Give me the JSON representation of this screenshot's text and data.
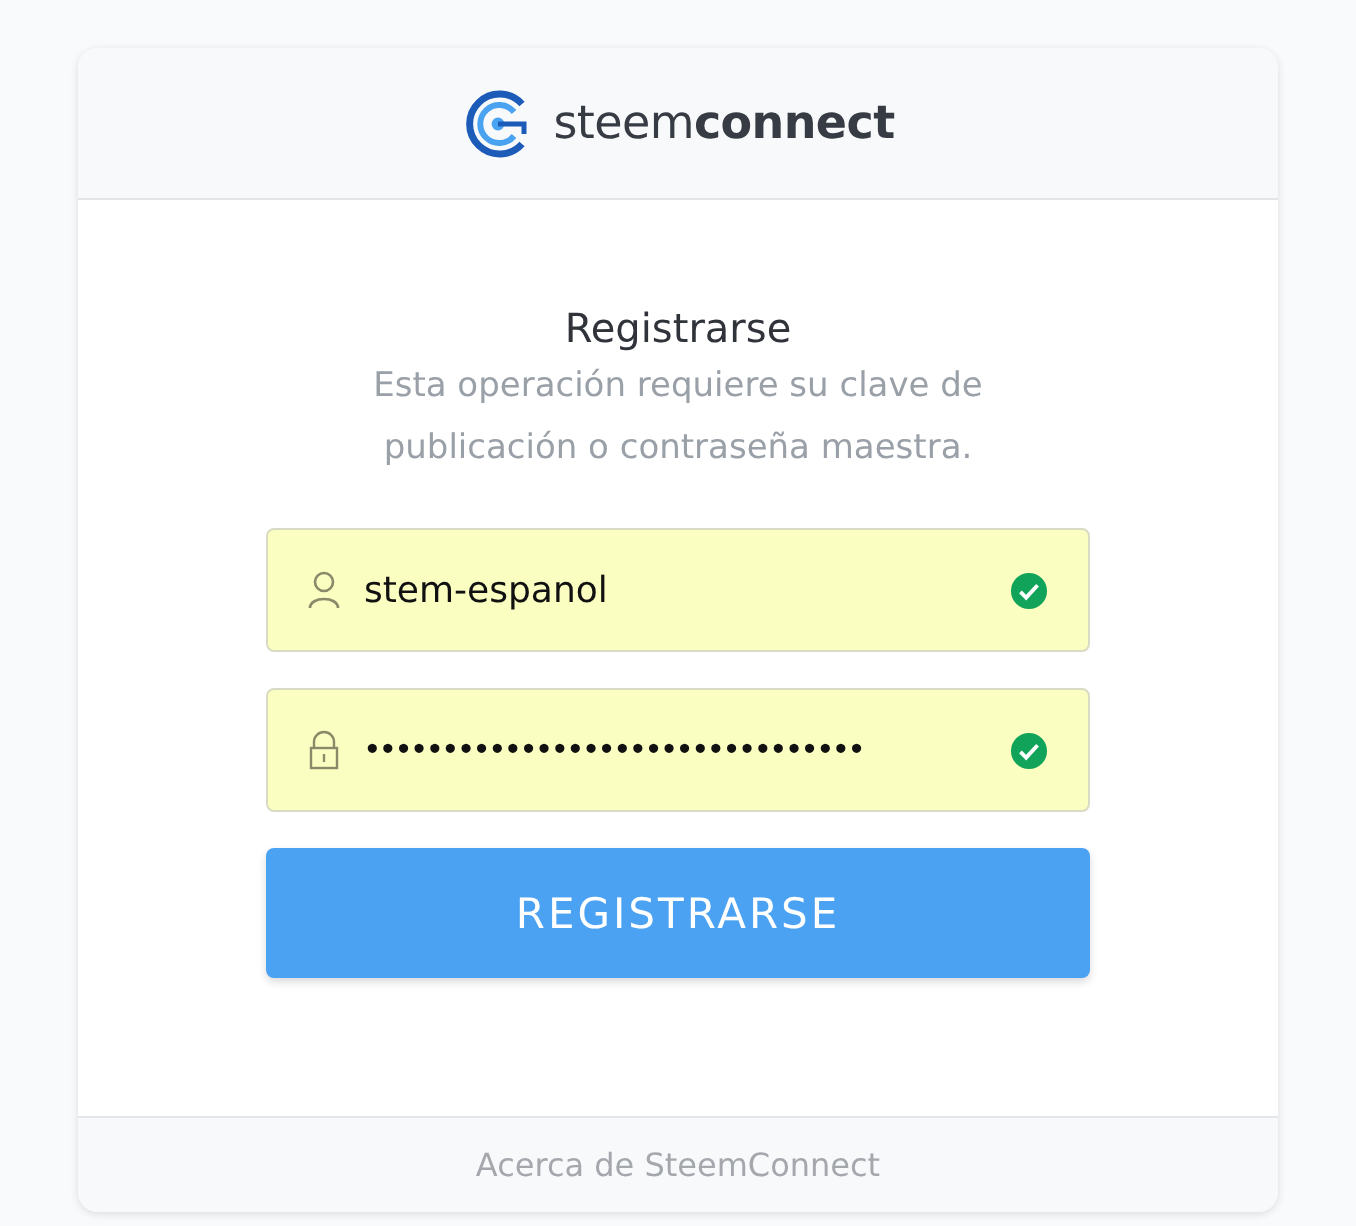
{
  "header": {
    "brand": "steem**connect**"
  },
  "form": {
    "title": "Registrarse",
    "description": "Esta operación requiere su clave de publicación o contraseña maestra.",
    "fields": [
      {
        "kind": "user",
        "value": "stem-espanol",
        "valid": true
      },
      {
        "kind": "password",
        "value": "••••••••••••••••••••••••••••••••",
        "valid": true
      }
    ],
    "submit": "REGISTRARSE"
  },
  "footer": {
    "link": "Acerca de SteemConnect"
  }
}
